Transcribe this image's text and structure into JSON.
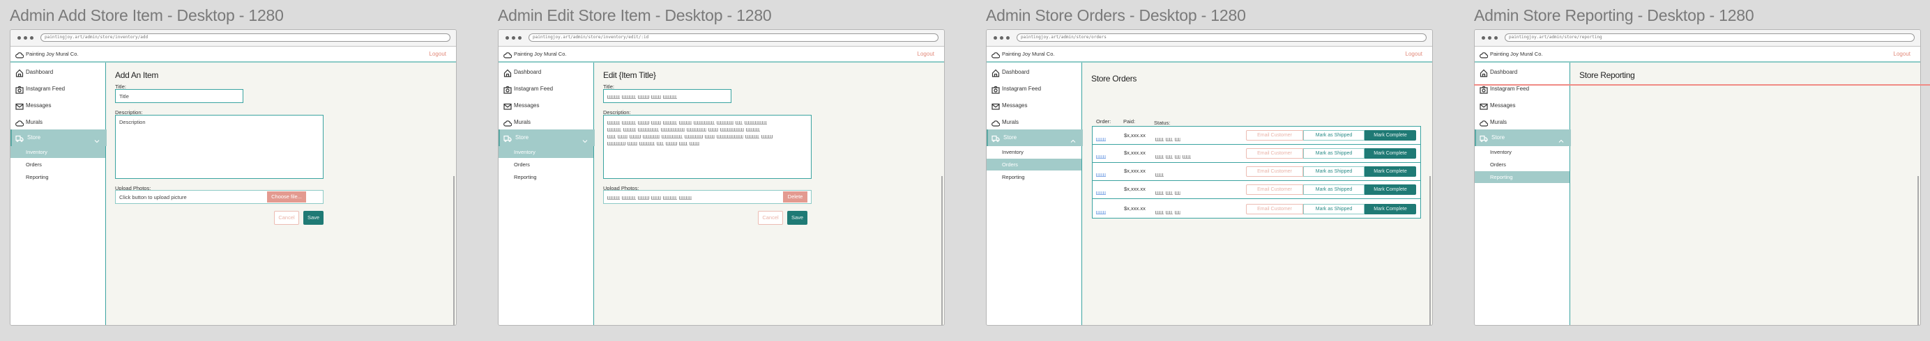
{
  "common": {
    "brand": "Painting Joy Mural Co.",
    "logout": "Logout",
    "nav": [
      {
        "label": "Dashboard",
        "icon": "home-icon"
      },
      {
        "label": "Instagram Feed",
        "icon": "camera-icon"
      },
      {
        "label": "Messages",
        "icon": "mail-icon"
      },
      {
        "label": "Murals",
        "icon": "cloud-icon"
      }
    ],
    "store": {
      "label": "Store",
      "icon": "truck-icon",
      "sub": [
        "Inventory",
        "Orders",
        "Reporting"
      ]
    }
  },
  "colors": {
    "teal_dark": "#1f7a75",
    "teal_light": "#a2cbc9",
    "salmon": "#e39a90",
    "logout": "#e28a7b"
  },
  "frames": [
    {
      "type": "add",
      "title": "Admin Add Store Item - Desktop - 1280",
      "url": "paintingjoy.art/admin/store/inventory/add",
      "active_sub": 0,
      "store_open_chevron": "down",
      "form": {
        "heading": "Add An Item",
        "title_label": "Title:",
        "title_placeholder": "Title",
        "desc_label": "Description:",
        "desc_placeholder": "Description",
        "upload_label": "Upload Photos:",
        "upload_text": "Click button to upload picture",
        "upload_button": "Choose file...",
        "cancel": "Cancel",
        "save": "Save"
      }
    },
    {
      "type": "edit",
      "title": "Admin Edit Store Item - Desktop - 1280",
      "url": "paintingjoy.art/admin/store/inventory/edit/:id",
      "active_sub": 0,
      "store_open_chevron": "down",
      "form": {
        "heading": "Edit {Item Title}",
        "title_label": "Title:",
        "desc_label": "Description:",
        "upload_label": "Upload Photos:",
        "upload_button": "Delete",
        "cancel": "Cancel",
        "save": "Save"
      }
    },
    {
      "type": "orders",
      "title": "Admin Store Orders - Desktop - 1280",
      "url": "paintingjoy.art/admin/store/orders",
      "active_sub": 1,
      "store_open_chevron": "up",
      "orders": {
        "heading": "Store Orders",
        "columns": [
          "Order:",
          "Paid:",
          "Status:"
        ],
        "rows": [
          {
            "paid": "$x,xxx.xx"
          },
          {
            "paid": "$x,xxx.xx"
          },
          {
            "paid": "$x,xxx.xx"
          },
          {
            "paid": "$x,xxx.xx"
          },
          {
            "paid": "$x,xxx.xx"
          }
        ],
        "email_label": "Email Customer",
        "ship_label": "Mark as Shipped",
        "complete_label": "Mark Complete"
      }
    },
    {
      "type": "reporting",
      "title": "Admin Store Reporting - Desktop - 1280",
      "url": "paintingjoy.art/admin/store/reporting",
      "active_sub": 2,
      "store_open_chevron": "up",
      "reporting": {
        "heading": "Store Reporting"
      }
    }
  ]
}
